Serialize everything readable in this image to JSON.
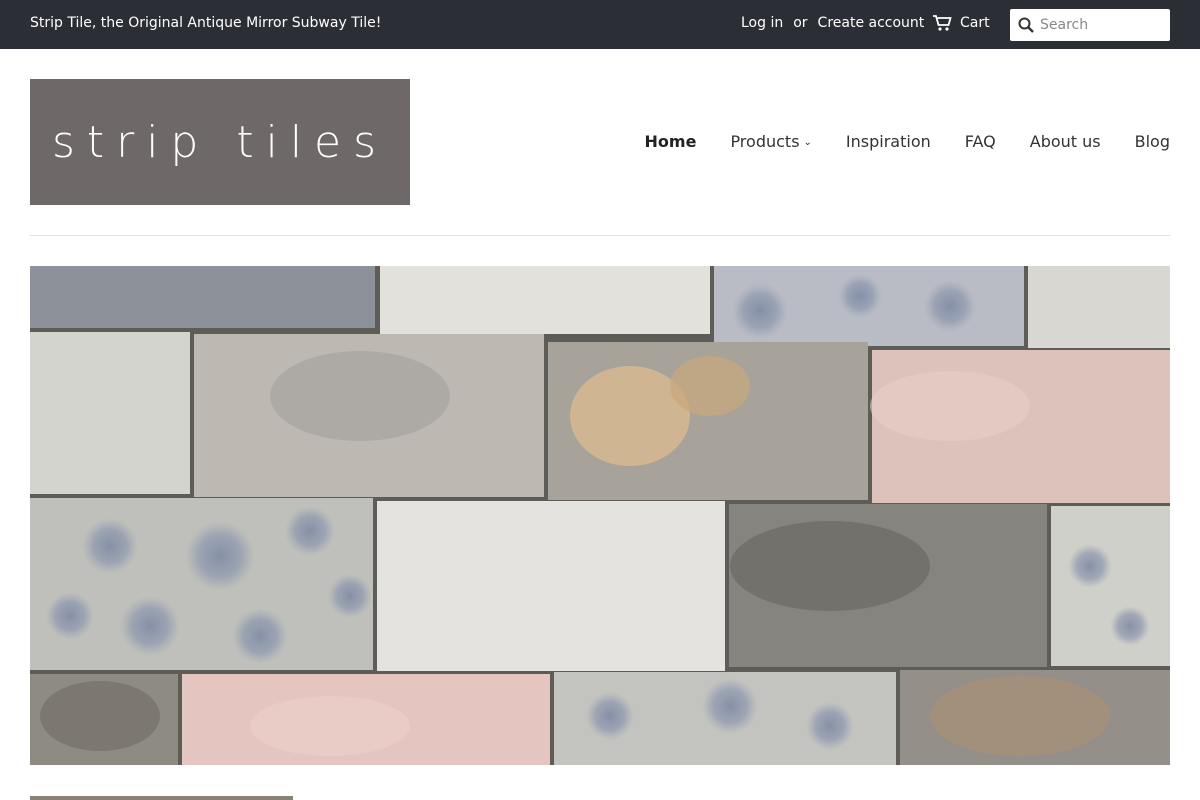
{
  "topbar": {
    "tagline": "Strip Tile, the Original Antique Mirror Subway Tile!",
    "login": "Log in",
    "or": "or",
    "create_account": "Create account",
    "cart": "Cart",
    "search_placeholder": "Search"
  },
  "header": {
    "logo_text": "strip tiles"
  },
  "nav": {
    "items": [
      {
        "label": "Home"
      },
      {
        "label": "Products"
      },
      {
        "label": "Inspiration"
      },
      {
        "label": "FAQ"
      },
      {
        "label": "About us"
      },
      {
        "label": "Blog"
      }
    ]
  },
  "colors": {
    "topbar_bg": "#2b2f35",
    "logo_bg": "#6e6868"
  }
}
